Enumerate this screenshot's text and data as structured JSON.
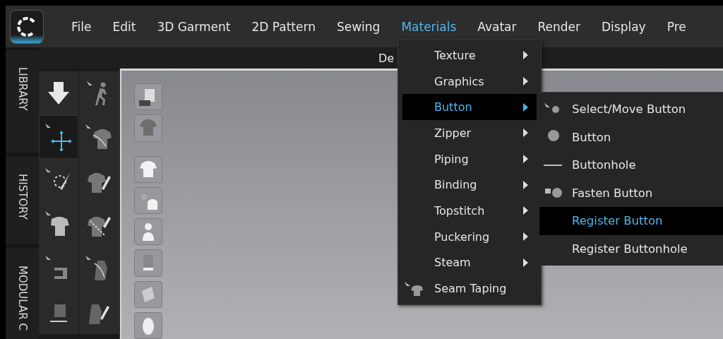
{
  "menubar": {
    "items": [
      {
        "label": "File",
        "selected": false
      },
      {
        "label": "Edit",
        "selected": false
      },
      {
        "label": "3D Garment",
        "selected": false
      },
      {
        "label": "2D Pattern",
        "selected": false
      },
      {
        "label": "Sewing",
        "selected": false
      },
      {
        "label": "Materials",
        "selected": true
      },
      {
        "label": "Avatar",
        "selected": false
      },
      {
        "label": "Render",
        "selected": false
      },
      {
        "label": "Display",
        "selected": false
      },
      {
        "label": "Pre",
        "selected": false
      }
    ]
  },
  "window_title": "De",
  "side_tabs": [
    "LIBRARY",
    "HISTORY",
    "MODULAR C"
  ],
  "tools": [
    {
      "selected": false
    },
    {
      "selected": false
    },
    {
      "selected": true
    },
    {
      "selected": false
    },
    {
      "selected": false
    },
    {
      "selected": false
    },
    {
      "selected": false
    },
    {
      "selected": false
    },
    {
      "selected": false
    },
    {
      "selected": false
    },
    {
      "selected": false
    },
    {
      "selected": false
    }
  ],
  "materials_menu": [
    {
      "label": "Texture",
      "submenu": true,
      "selected": false
    },
    {
      "label": "Graphics",
      "submenu": true,
      "selected": false
    },
    {
      "label": "Button",
      "submenu": true,
      "selected": true
    },
    {
      "label": "Zipper",
      "submenu": true,
      "selected": false
    },
    {
      "label": "Piping",
      "submenu": true,
      "selected": false
    },
    {
      "label": "Binding",
      "submenu": true,
      "selected": false
    },
    {
      "label": "Topstitch",
      "submenu": true,
      "selected": false
    },
    {
      "label": "Puckering",
      "submenu": true,
      "selected": false
    },
    {
      "label": "Steam",
      "submenu": true,
      "selected": false
    },
    {
      "label": "Seam Taping",
      "submenu": false,
      "selected": false
    }
  ],
  "button_submenu": [
    {
      "label": "Select/Move Button",
      "selected": false
    },
    {
      "label": "Button",
      "selected": false
    },
    {
      "label": "Buttonhole",
      "selected": false
    },
    {
      "label": "Fasten Button",
      "selected": false
    },
    {
      "label": "Register Button",
      "selected": true
    },
    {
      "label": "Register Buttonhole",
      "selected": false
    }
  ]
}
